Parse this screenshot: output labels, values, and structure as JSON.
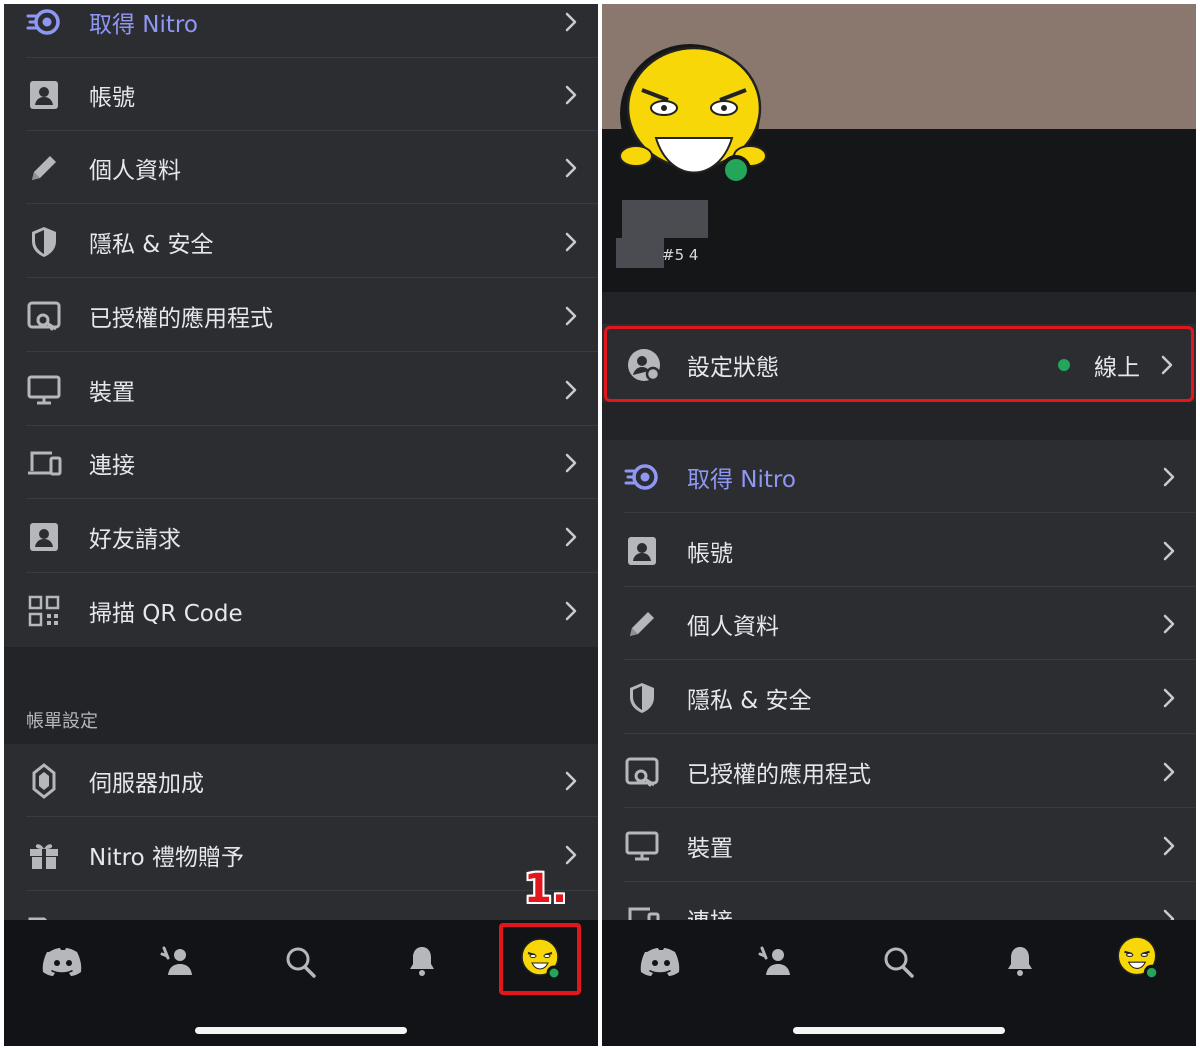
{
  "left": {
    "menu_top": [
      {
        "id": "nitro",
        "label": "取得 Nitro",
        "icon": "nitro-icon"
      },
      {
        "id": "account",
        "label": "帳號",
        "icon": "account-icon"
      },
      {
        "id": "profile",
        "label": "個人資料",
        "icon": "pencil-icon"
      },
      {
        "id": "privacy",
        "label": "隱私 & 安全",
        "icon": "shield-icon"
      },
      {
        "id": "apps",
        "label": "已授權的應用程式",
        "icon": "authorized-apps-icon"
      },
      {
        "id": "devices",
        "label": "裝置",
        "icon": "monitor-icon"
      },
      {
        "id": "connections",
        "label": "連接",
        "icon": "devices-icon"
      },
      {
        "id": "friend-requests",
        "label": "好友請求",
        "icon": "account-icon"
      },
      {
        "id": "scan-qr",
        "label": "掃描 QR Code",
        "icon": "qr-code-icon"
      }
    ],
    "billing_section_title": "帳單設定",
    "menu_billing": [
      {
        "id": "server-boost",
        "label": "伺服器加成",
        "icon": "boost-icon"
      },
      {
        "id": "nitro-gift",
        "label": "Nitro 禮物贈予",
        "icon": "gift-icon"
      }
    ],
    "step_label": "1."
  },
  "right": {
    "tag": "#5  4",
    "status": {
      "label": "設定狀態",
      "value": "線上",
      "color": "#23a55a"
    },
    "menu": [
      {
        "id": "nitro",
        "label": "取得 Nitro",
        "icon": "nitro-icon"
      },
      {
        "id": "account",
        "label": "帳號",
        "icon": "account-icon"
      },
      {
        "id": "profile",
        "label": "個人資料",
        "icon": "pencil-icon"
      },
      {
        "id": "privacy",
        "label": "隱私 & 安全",
        "icon": "shield-icon"
      },
      {
        "id": "apps",
        "label": "已授權的應用程式",
        "icon": "authorized-apps-icon"
      },
      {
        "id": "devices",
        "label": "裝置",
        "icon": "monitor-icon"
      },
      {
        "id": "connections",
        "label": "連接",
        "icon": "devices-icon"
      }
    ]
  },
  "tabs": [
    {
      "id": "home",
      "icon": "discord-logo-icon"
    },
    {
      "id": "friends",
      "icon": "friends-wave-icon"
    },
    {
      "id": "search",
      "icon": "search-icon"
    },
    {
      "id": "notifications",
      "icon": "bell-icon"
    },
    {
      "id": "you",
      "icon": "avatar-icon"
    }
  ],
  "colors": {
    "background": "#2c2d31",
    "section_gap": "#232428",
    "tabbar": "#121316",
    "nitro_accent": "#8f97f5",
    "online": "#23a55a",
    "annotation_red": "#e3161d",
    "banner": "#8a786e"
  }
}
